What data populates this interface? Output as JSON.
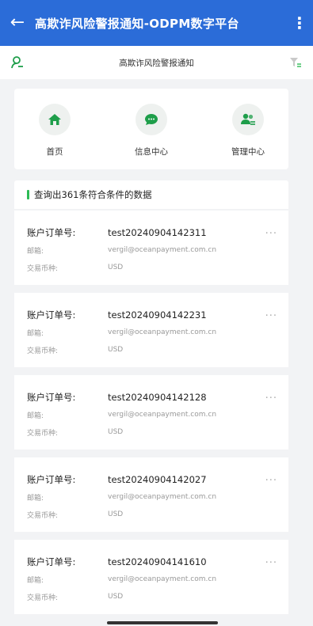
{
  "app_bar": {
    "title": "高欺诈风险警报通知-ODPM数字平台",
    "back_icon": "arrow-left-icon",
    "more_icon": "more-vertical-icon"
  },
  "sub_bar": {
    "title": "高欺诈风险警报通知",
    "user_icon": "user-icon",
    "filter_icon": "filter-icon"
  },
  "menu": [
    {
      "label": "首页",
      "icon": "home-icon"
    },
    {
      "label": "信息中心",
      "icon": "message-icon"
    },
    {
      "label": "管理中心",
      "icon": "users-icon"
    }
  ],
  "result_text": "查询出361条符合条件的数据",
  "field_labels": {
    "order": "账户订单号:",
    "email": "邮箱:",
    "currency": "交易币种:"
  },
  "records": [
    {
      "order": "test20240904142311",
      "email": "vergil@oceanpayment.com.cn",
      "currency": "USD"
    },
    {
      "order": "test20240904142231",
      "email": "vergil@oceanpayment.com.cn",
      "currency": "USD"
    },
    {
      "order": "test20240904142128",
      "email": "vergil@oceanpayment.com.cn",
      "currency": "USD"
    },
    {
      "order": "test20240904142027",
      "email": "vergil@oceanpayment.com.cn",
      "currency": "USD"
    },
    {
      "order": "test20240904141610",
      "email": "vergil@oceanpayment.com.cn",
      "currency": "USD"
    }
  ],
  "more_label": "···",
  "colors": {
    "primary": "#2b6cd8",
    "accent_green": "#2dbb55",
    "icon_green": "#1e9e4a"
  }
}
